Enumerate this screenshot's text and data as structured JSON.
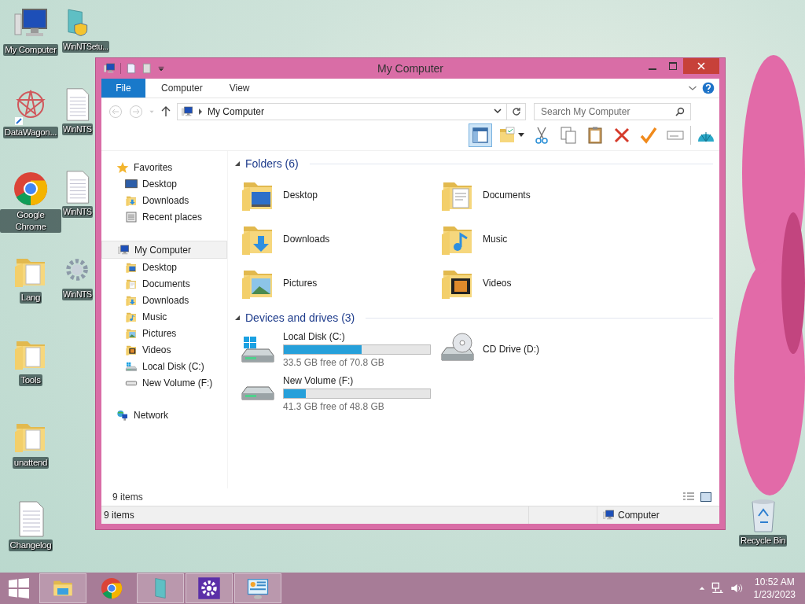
{
  "desktop": {
    "icons": [
      {
        "label": "My Computer"
      },
      {
        "label": "DataWagon..."
      },
      {
        "label": "Google Chrome"
      },
      {
        "label": "Lang"
      },
      {
        "label": "Tools"
      },
      {
        "label": "unattend"
      },
      {
        "label": "Changelog"
      },
      {
        "label": "WinNTSetu..."
      },
      {
        "label": "WinNTS"
      },
      {
        "label": "WinNTS"
      },
      {
        "label": "WinNTS"
      }
    ],
    "recycle_bin": {
      "label": "Recycle Bin"
    }
  },
  "window": {
    "title": "My Computer",
    "tabs": [
      {
        "label": "File",
        "kind": "app",
        "selected": false
      },
      {
        "label": "Computer",
        "kind": "tab",
        "selected": false
      },
      {
        "label": "View",
        "kind": "tab",
        "selected": false
      }
    ],
    "address": {
      "path": "My Computer"
    },
    "search": {
      "placeholder": "Search My Computer"
    },
    "sidebar": [
      {
        "label": "Favorites",
        "selected": false,
        "children": [
          {
            "label": "Desktop",
            "selected": false
          },
          {
            "label": "Downloads",
            "selected": false
          },
          {
            "label": "Recent places",
            "selected": false
          }
        ]
      },
      {
        "label": "My Computer",
        "selected": true,
        "children": [
          {
            "label": "Desktop",
            "selected": false
          },
          {
            "label": "Documents",
            "selected": false
          },
          {
            "label": "Downloads",
            "selected": false
          },
          {
            "label": "Music",
            "selected": false
          },
          {
            "label": "Pictures",
            "selected": false
          },
          {
            "label": "Videos",
            "selected": false
          },
          {
            "label": "Local Disk (C:)",
            "selected": false
          },
          {
            "label": "New Volume (F:)",
            "selected": false
          }
        ]
      },
      {
        "label": "Network",
        "selected": false
      }
    ],
    "sections": [
      {
        "title": "Folders (6)",
        "expanded": true,
        "kind": "folders",
        "items": [
          {
            "label": "Desktop"
          },
          {
            "label": "Documents"
          },
          {
            "label": "Downloads"
          },
          {
            "label": "Music"
          },
          {
            "label": "Pictures"
          },
          {
            "label": "Videos"
          }
        ]
      },
      {
        "title": "Devices and drives (3)",
        "expanded": true,
        "kind": "drives",
        "items": [
          {
            "label": "Local Disk (C:)",
            "kind": "disk",
            "level": 0.53,
            "free": "33.5 GB free of 70.8 GB"
          },
          {
            "label": "CD Drive (D:)",
            "kind": "optical"
          },
          {
            "label": "New Volume (F:)",
            "kind": "disk",
            "level": 0.15,
            "free": "41.3 GB free of 48.8 GB"
          }
        ]
      }
    ],
    "item_count": "9 items",
    "status_bar": {
      "items": "9 items",
      "location": "Computer"
    }
  },
  "taskbar": {
    "apps": [
      {
        "running": true
      },
      {
        "running": false
      },
      {
        "running": true
      },
      {
        "running": true
      },
      {
        "running": true
      }
    ],
    "clock": {
      "time": "10:52 AM",
      "date": "1/23/2023"
    }
  }
}
